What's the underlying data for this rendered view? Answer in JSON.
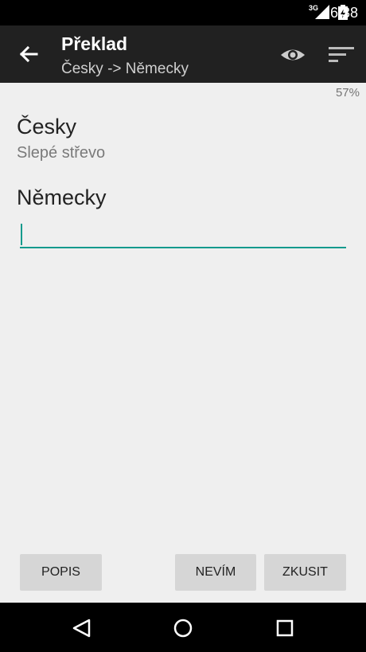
{
  "status_bar": {
    "time": "6:38",
    "network": "3G"
  },
  "toolbar": {
    "title": "Překlad",
    "subtitle": "Česky -> Německy"
  },
  "progress": {
    "label": "57%",
    "value": 57
  },
  "source": {
    "language": "Česky",
    "text": "Slepé střevo"
  },
  "target": {
    "language": "Německy",
    "answer_value": ""
  },
  "buttons": {
    "popis": "POPIS",
    "nevim": "NEVÍM",
    "zkusit": "ZKUSIT"
  },
  "colors": {
    "accent": "#139a8d",
    "toolbar": "#212121",
    "background": "#efefef"
  },
  "icons": [
    "back-arrow-icon",
    "eye-icon",
    "sort-icon",
    "signal-icon",
    "battery-icon",
    "nav-back-icon",
    "nav-home-icon",
    "nav-recents-icon"
  ]
}
